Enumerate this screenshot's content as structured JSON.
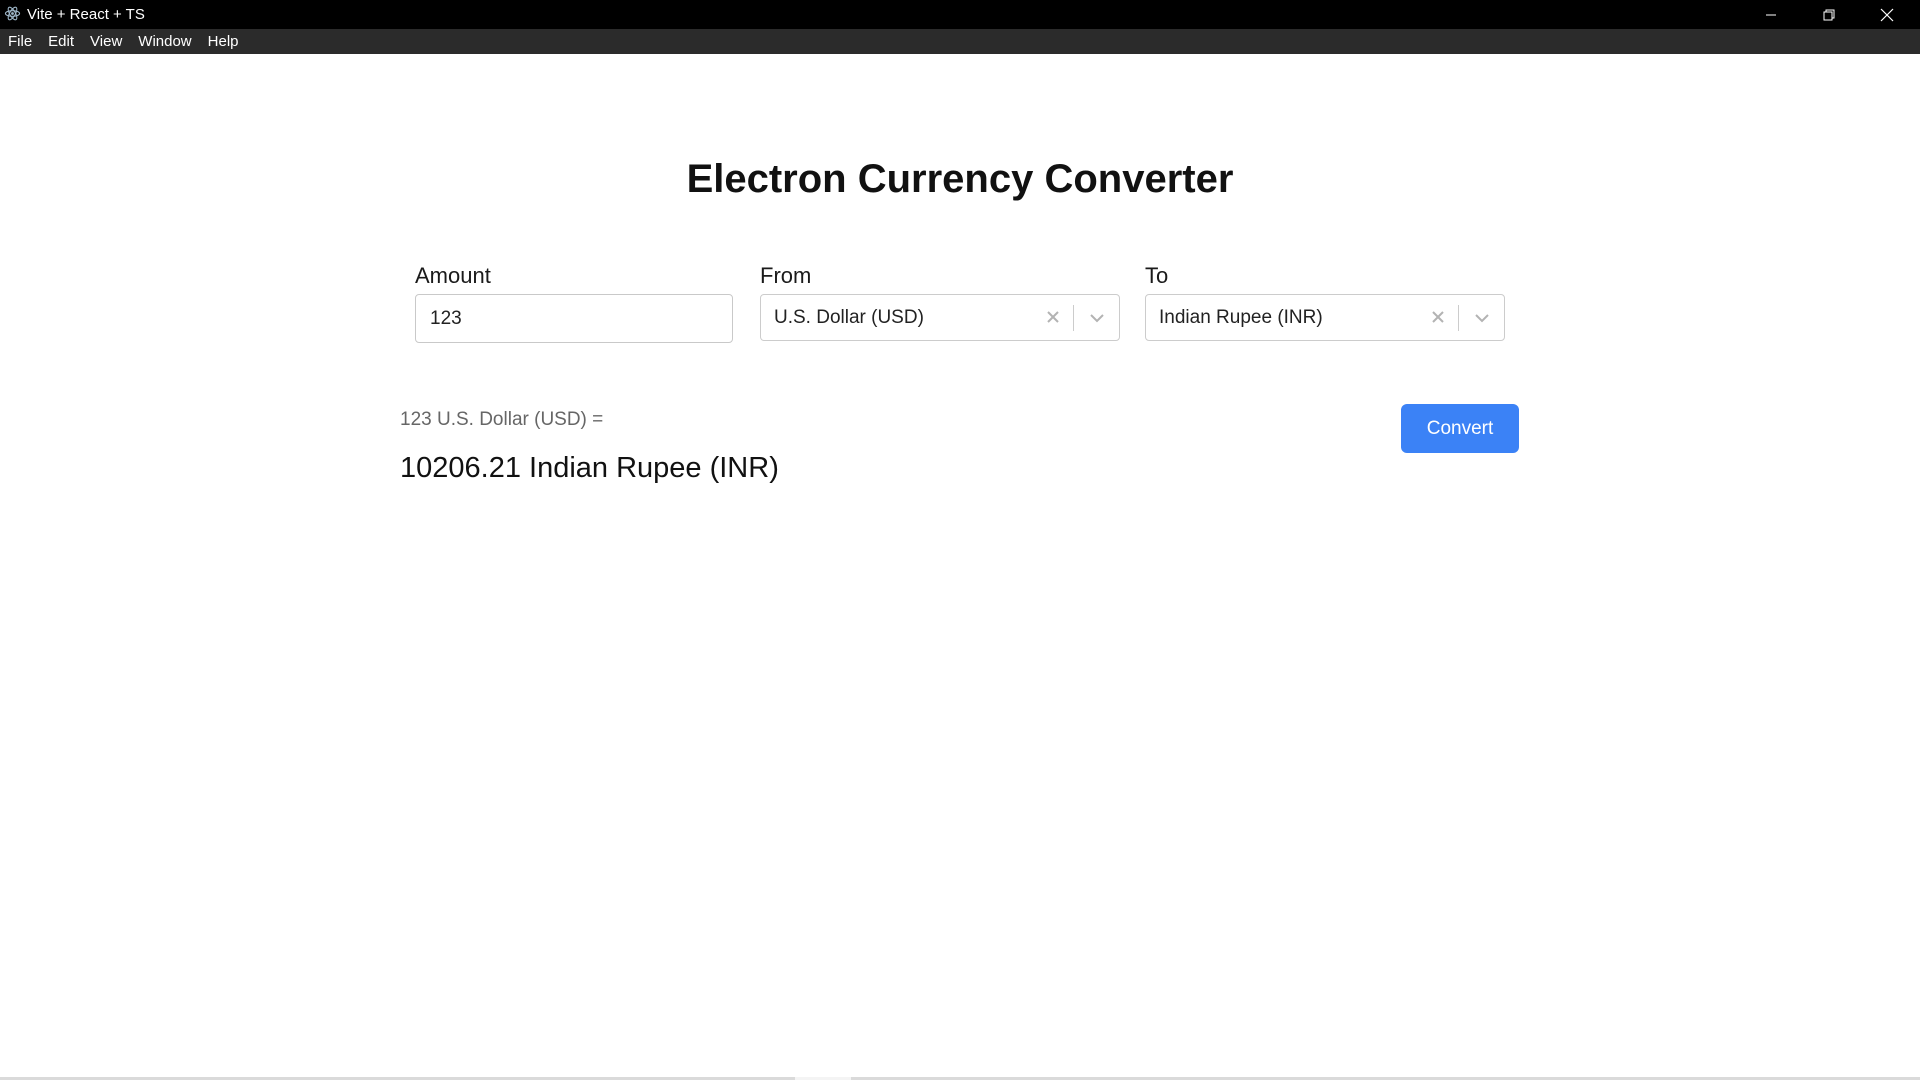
{
  "window": {
    "title": "Vite + React + TS",
    "icons": {
      "app": "electron-icon",
      "minimize": "minimize-icon",
      "maximize": "restore-icon",
      "close": "close-icon"
    }
  },
  "menubar": {
    "items": [
      {
        "label": "File"
      },
      {
        "label": "Edit"
      },
      {
        "label": "View"
      },
      {
        "label": "Window"
      },
      {
        "label": "Help"
      }
    ]
  },
  "page": {
    "title": "Electron Currency Converter"
  },
  "form": {
    "amount": {
      "label": "Amount",
      "value": "123"
    },
    "from": {
      "label": "From",
      "selected": "U.S. Dollar (USD)"
    },
    "to": {
      "label": "To",
      "selected": "Indian Rupee (INR)"
    },
    "convert_label": "Convert"
  },
  "result": {
    "source_line": "123 U.S. Dollar (USD) =",
    "converted_line": "10206.21 Indian Rupee (INR)"
  },
  "colors": {
    "accent": "#3b82f6",
    "titlebar": "#000000",
    "menubar": "#2b2b2b"
  }
}
